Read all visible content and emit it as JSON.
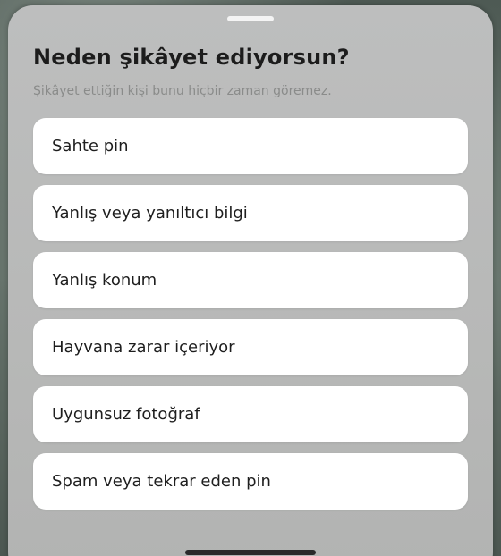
{
  "sheet": {
    "title": "Neden şikâyet ediyorsun?",
    "subtitle": "Şikâyet ettiğin kişi bunu hiçbir zaman göremez.",
    "options": [
      {
        "label": "Sahte pin"
      },
      {
        "label": "Yanlış veya yanıltıcı bilgi"
      },
      {
        "label": "Yanlış konum"
      },
      {
        "label": "Hayvana zarar içeriyor"
      },
      {
        "label": "Uygunsuz fotoğraf"
      },
      {
        "label": "Spam veya tekrar eden pin"
      }
    ]
  }
}
